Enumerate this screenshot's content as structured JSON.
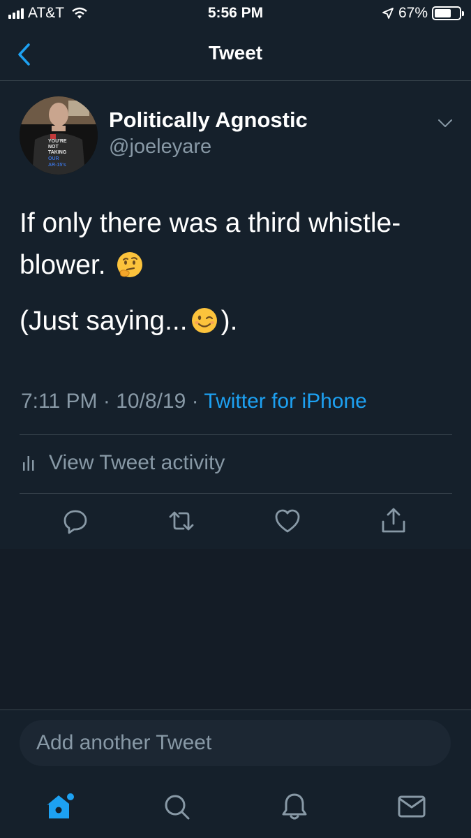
{
  "status_bar": {
    "carrier": "AT&T",
    "time": "5:56 PM",
    "battery": "67%",
    "battery_level": 0.67
  },
  "header": {
    "title": "Tweet",
    "back_icon": "chevron-left-icon"
  },
  "tweet": {
    "author_name": "Politically Agnostic",
    "author_handle": "@joeleyare",
    "avatar_shirt_text": [
      "YOU'RE",
      "NOT",
      "TAKING",
      "OUR",
      "AR-15's"
    ],
    "text_line1": "If only there was a third whistle-",
    "text_line2_before": "blower.",
    "text_line2_emoji": "thinking-face-icon",
    "text_line3_before": "(Just saying...",
    "text_line3_emoji": "winking-face-icon",
    "text_line3_after": ").",
    "time": "7:11 PM",
    "date": "10/8/19",
    "separator": "·",
    "source": "Twitter for iPhone"
  },
  "activity": {
    "label": "View Tweet activity"
  },
  "actions": [
    "reply-icon",
    "retweet-icon",
    "like-icon",
    "share-icon"
  ],
  "composer": {
    "placeholder": "Add another Tweet"
  },
  "tab_bar": [
    "home-icon",
    "search-icon",
    "notifications-icon",
    "messages-icon"
  ],
  "colors": {
    "background": "#15202b",
    "accent": "#1da1f2",
    "secondary_text": "#8899a6",
    "divider": "#38444d"
  }
}
